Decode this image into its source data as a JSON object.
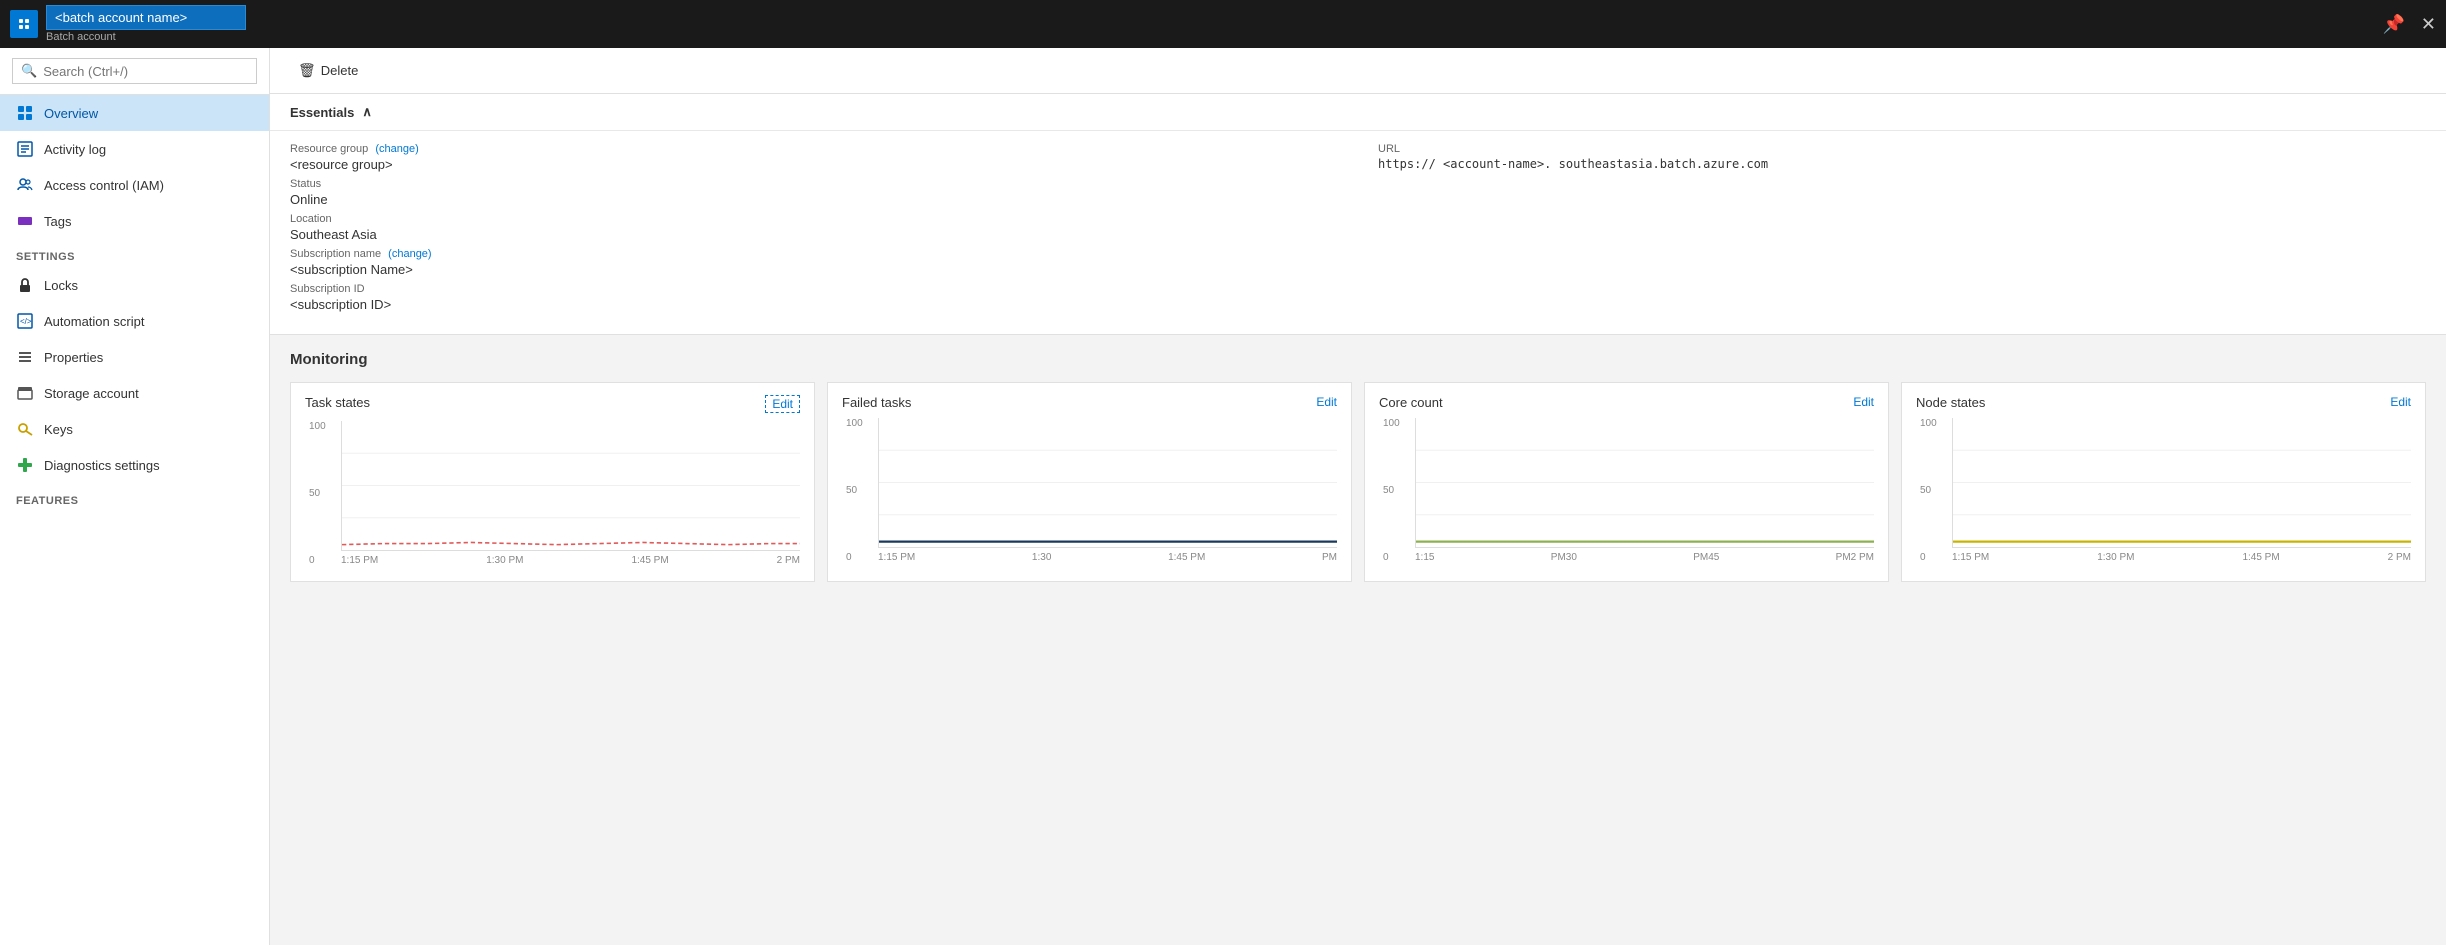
{
  "topbar": {
    "icon": "⚙",
    "input_value": "<batch account name>",
    "subtitle": "Batch account",
    "pin_label": "📌",
    "close_label": "✕"
  },
  "sidebar": {
    "search_placeholder": "Search (Ctrl+/)",
    "nav_items": [
      {
        "id": "overview",
        "label": "Overview",
        "icon": "🏠",
        "active": true
      },
      {
        "id": "activity-log",
        "label": "Activity log",
        "icon": "📋",
        "active": false
      },
      {
        "id": "access-control",
        "label": "Access control (IAM)",
        "icon": "👥",
        "active": false
      },
      {
        "id": "tags",
        "label": "Tags",
        "icon": "🏷",
        "active": false
      }
    ],
    "settings_label": "SETTINGS",
    "settings_items": [
      {
        "id": "locks",
        "label": "Locks",
        "icon": "🔒"
      },
      {
        "id": "automation-script",
        "label": "Automation script",
        "icon": "📄"
      },
      {
        "id": "properties",
        "label": "Properties",
        "icon": "≡"
      },
      {
        "id": "storage-account",
        "label": "Storage account",
        "icon": "🗄"
      },
      {
        "id": "keys",
        "label": "Keys",
        "icon": "🔑"
      },
      {
        "id": "diagnostics-settings",
        "label": "Diagnostics settings",
        "icon": "➕"
      }
    ],
    "features_label": "FEATURES"
  },
  "toolbar": {
    "delete_label": "Delete",
    "delete_icon": "🗑"
  },
  "essentials": {
    "header_label": "Essentials",
    "collapse_icon": "∧",
    "resource_group_label": "Resource group",
    "resource_group_change": "(change)",
    "resource_group_value": "<resource group>",
    "url_label": "URL",
    "url_value": "https://  <account-name>.  southeastasia.batch.azure.com",
    "status_label": "Status",
    "status_value": "Online",
    "location_label": "Location",
    "location_value": "Southeast Asia",
    "subscription_name_label": "Subscription name",
    "subscription_name_change": "(change)",
    "subscription_name_value": "<subscription Name>",
    "subscription_id_label": "Subscription ID",
    "subscription_id_value": "<subscription ID>"
  },
  "monitoring": {
    "section_title": "Monitoring",
    "cards": [
      {
        "id": "task-states",
        "title": "Task states",
        "edit_label": "Edit",
        "edit_dashed": true,
        "y_labels": [
          "100",
          "50",
          "0"
        ],
        "x_labels": [
          "1:15 PM",
          "1:30 PM",
          "1:45 PM",
          "2 PM"
        ],
        "line_color": "#e05a5a",
        "line_path": "M0,115 L30,114 L60,114 L90,113 L120,114 L150,115 L180,114 L210,113 L240,114 L270,115 L300,114"
      },
      {
        "id": "failed-tasks",
        "title": "Failed tasks",
        "edit_label": "Edit",
        "edit_dashed": false,
        "y_labels": [
          "100",
          "50",
          "0"
        ],
        "x_labels": [
          "1:15 PM",
          "1:30",
          "1:45 PM",
          "PM"
        ],
        "line_color": "#1a3a5c",
        "line_path": "M0,115 L60,115 L120,115 L180,115 L240,115 L300,115"
      },
      {
        "id": "core-count",
        "title": "Core count",
        "edit_label": "Edit",
        "edit_dashed": false,
        "y_labels": [
          "100",
          "50",
          "0"
        ],
        "x_labels": [
          "1:15",
          "PM30",
          "PM45",
          "PM2 PM"
        ],
        "line_color": "#8db050",
        "line_path": "M0,115 L60,115 L120,115 L180,115 L240,115 L300,115"
      },
      {
        "id": "node-states",
        "title": "Node states",
        "edit_label": "Edit",
        "edit_dashed": false,
        "y_labels": [
          "100",
          "50",
          "0"
        ],
        "x_labels": [
          "1:15 PM",
          "1:30 PM",
          "1:45 PM",
          "2 PM"
        ],
        "line_color": "#c8b400",
        "line_path": "M0,115 L60,115 L120,115 L180,115 L240,115 L300,115"
      }
    ]
  }
}
